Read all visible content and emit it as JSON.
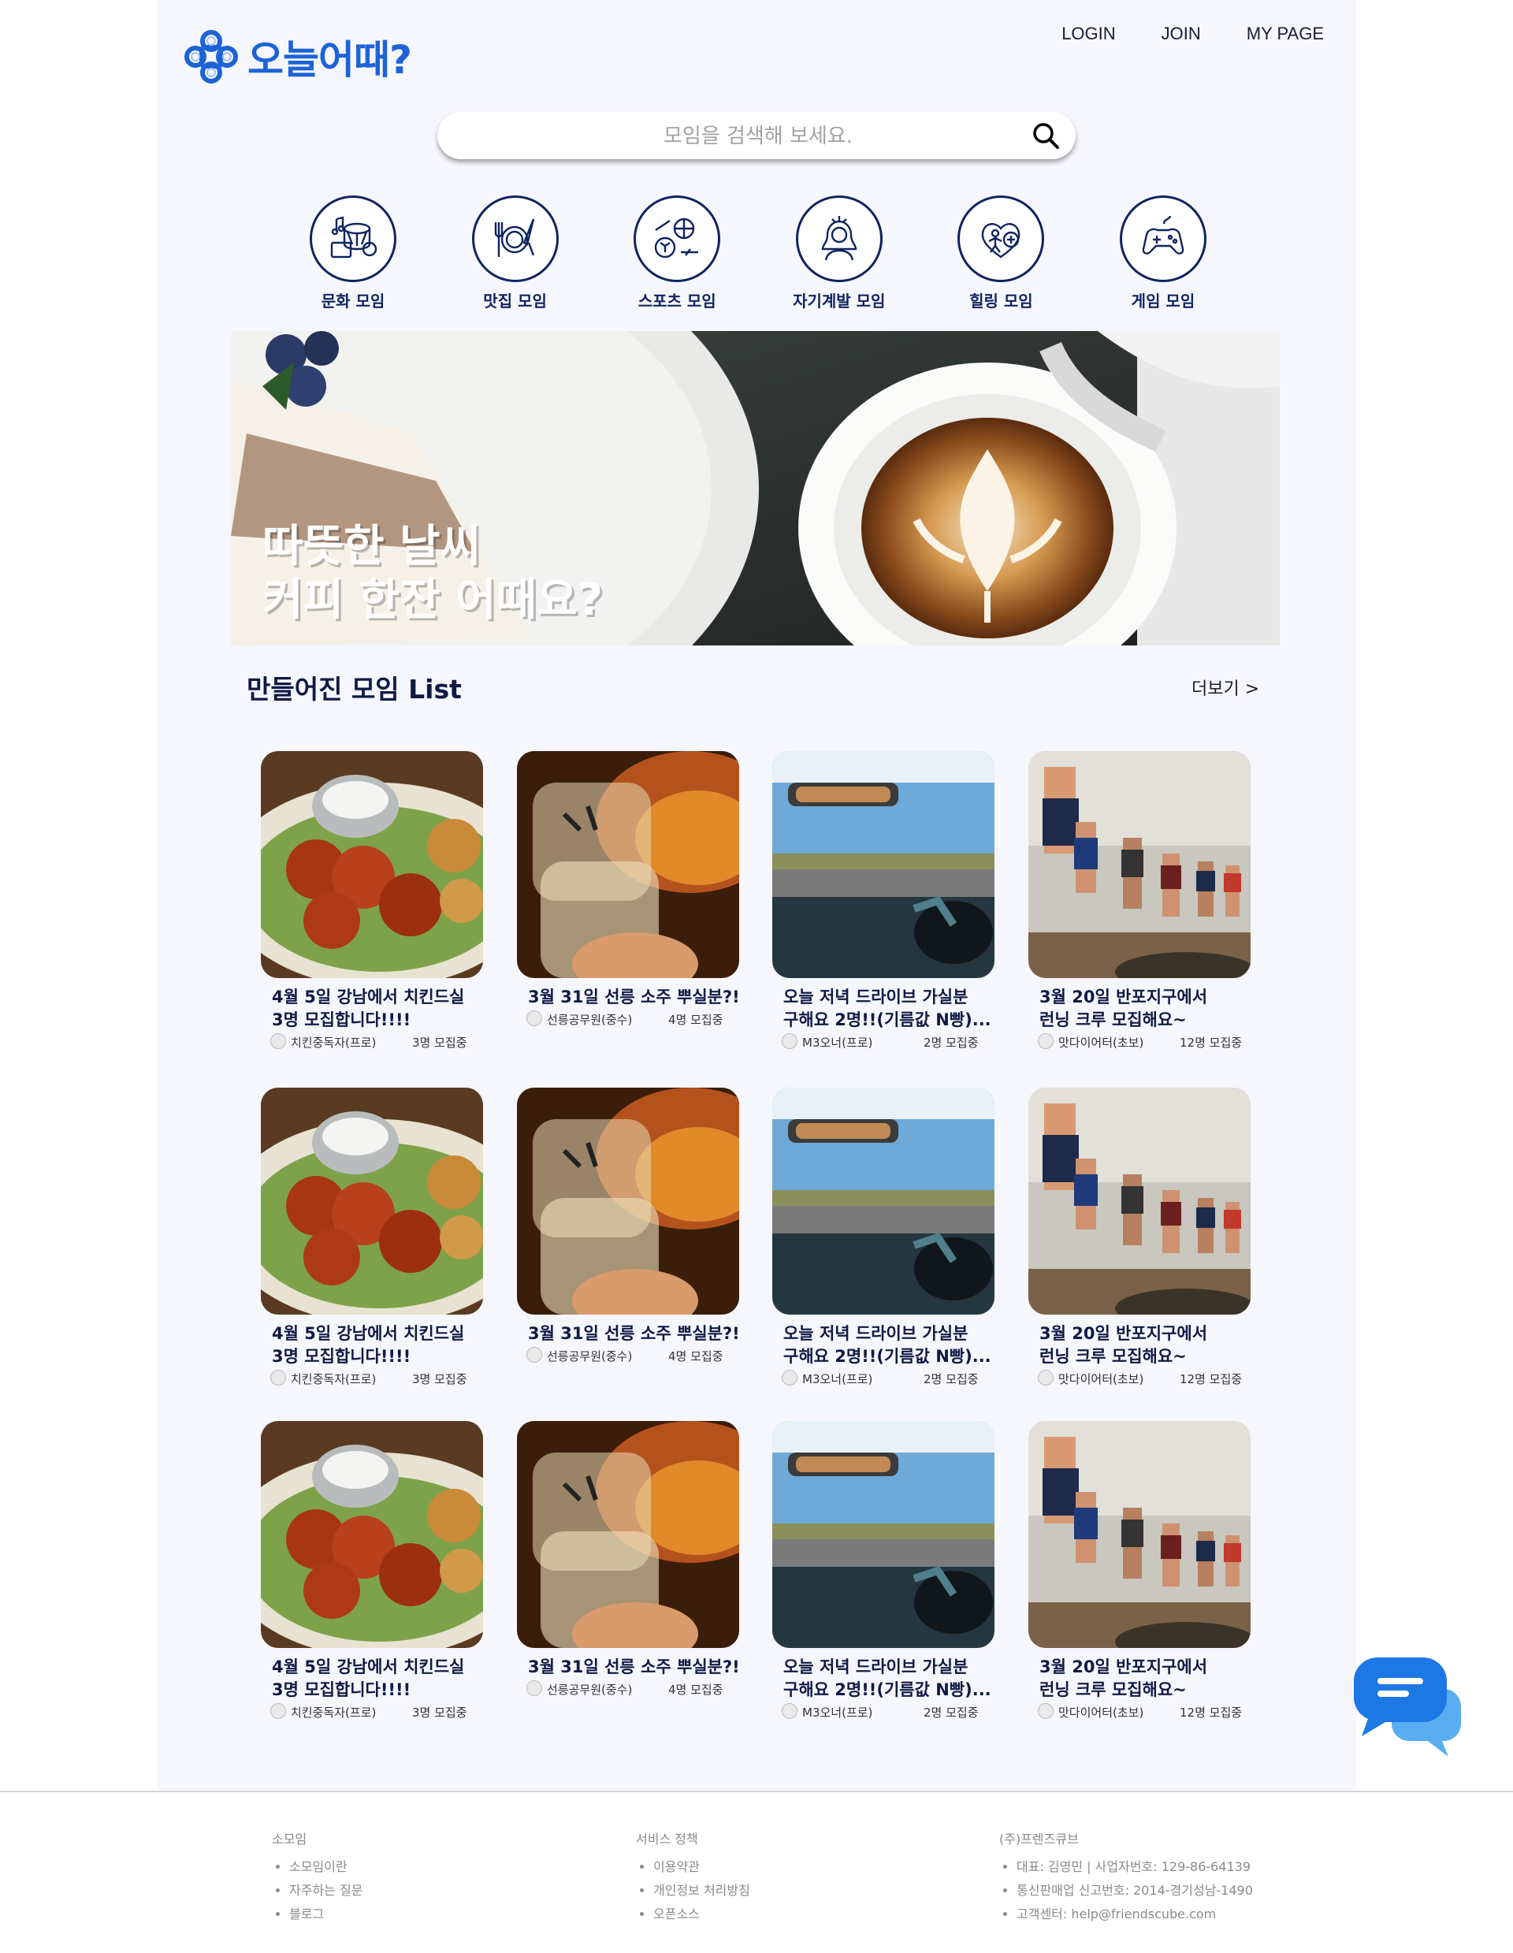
{
  "brand": {
    "name": "오늘어때?",
    "color": "#1e63d6"
  },
  "nav": {
    "login": "LOGIN",
    "join": "JOIN",
    "mypage": "MY PAGE"
  },
  "search": {
    "placeholder": "모임을 검색해 보세요.",
    "icon": "search-icon"
  },
  "categories": [
    {
      "label": "문화 모임",
      "icon": "culture-icon"
    },
    {
      "label": "맛집 모임",
      "icon": "dining-icon"
    },
    {
      "label": "스포츠 모임",
      "icon": "sports-icon"
    },
    {
      "label": "자기계발 모임",
      "icon": "self-development-icon"
    },
    {
      "label": "힐링 모임",
      "icon": "healing-icon"
    },
    {
      "label": "게임 모임",
      "icon": "game-icon"
    }
  ],
  "banner": {
    "line1": "따뜻한 날씨",
    "line2": "커피 한잔 어때요?"
  },
  "list": {
    "title": "만들어진 모임 List",
    "more": "더보기 >"
  },
  "cards": [
    {
      "title1": "4월 5일 강남에서 치킨드실",
      "title2": "3명 모집합니다!!!!",
      "author": "치킨중독자(프로)",
      "count": "3명 모집중",
      "image": "fried-chicken-photo"
    },
    {
      "title1": "3월 31일 선릉 소주 뿌실분?!",
      "title2": "",
      "author": "선릉공무원(중수)",
      "count": "4명 모집중",
      "image": "soju-glass-photo"
    },
    {
      "title1": "오늘 저녁 드라이브 가실분",
      "title2": "구해요 2명!!(기름값 N빵)...",
      "author": "M3오너(프로)",
      "count": "2명 모집중",
      "image": "car-drive-photo"
    },
    {
      "title1": "3월 20일 반포지구에서",
      "title2": "런닝 크루 모집해요~",
      "author": "맛다이어터(초보)",
      "count": "12명 모집중",
      "image": "runners-photo"
    }
  ],
  "footer": {
    "col1": {
      "head": "소모임",
      "items": [
        "소모임이란",
        "자주하는 질문",
        "블로그"
      ]
    },
    "col2": {
      "head": "서비스 정책",
      "items": [
        "이용약관",
        "개인정보 처리방침",
        "오픈소스"
      ]
    },
    "col3": {
      "head": "(주)프렌즈큐브",
      "items": [
        "대표: 김영민 | 사업자번호: 129-86-64139",
        "통신판매업 신고번호: 2014-경기성남-1490",
        "고객센터: help@friendscube.com"
      ]
    }
  }
}
